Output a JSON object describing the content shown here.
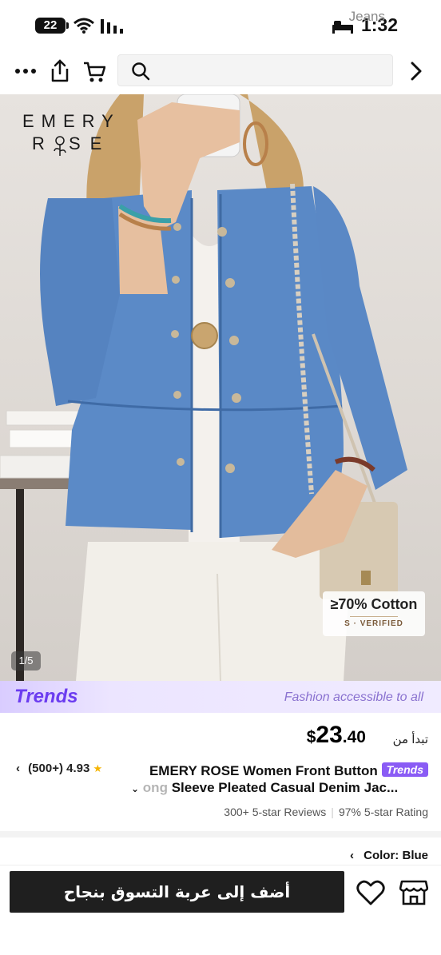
{
  "status_bar": {
    "battery": "22",
    "time": "1:32"
  },
  "search": {
    "placeholder": "Jeans"
  },
  "hero": {
    "brand_line1": "EMERY",
    "brand_line2": "R  SE",
    "page_indicator": "1/5",
    "badge_main": "≥70% Cotton",
    "badge_sub": "S · VERIFIED"
  },
  "banner": {
    "logo": "Trends",
    "tagline": "Fashion accessible to all"
  },
  "price": {
    "label": "تبدأ من",
    "currency": "$",
    "whole": "23",
    "decimal": ".40"
  },
  "product": {
    "rating": "(500+) 4.93",
    "title_line1": "EMERY ROSE Women Front Button",
    "title_pill": "Trends",
    "title_faded": "ong",
    "title_line2": "Sleeve Pleated Casual Denim Jac...",
    "reviews": "300+ 5-star Reviews",
    "rating_pct": "97% 5-star Rating"
  },
  "color_option": {
    "label": "Color:",
    "value": "Blue"
  },
  "actions": {
    "add_to_cart": "أضف إلى عربة التسوق بنجاح"
  },
  "colors": {
    "accent_purple": "#6b3cf0",
    "denim": "#5b8ac7",
    "button_dark": "#1f1f1f"
  }
}
